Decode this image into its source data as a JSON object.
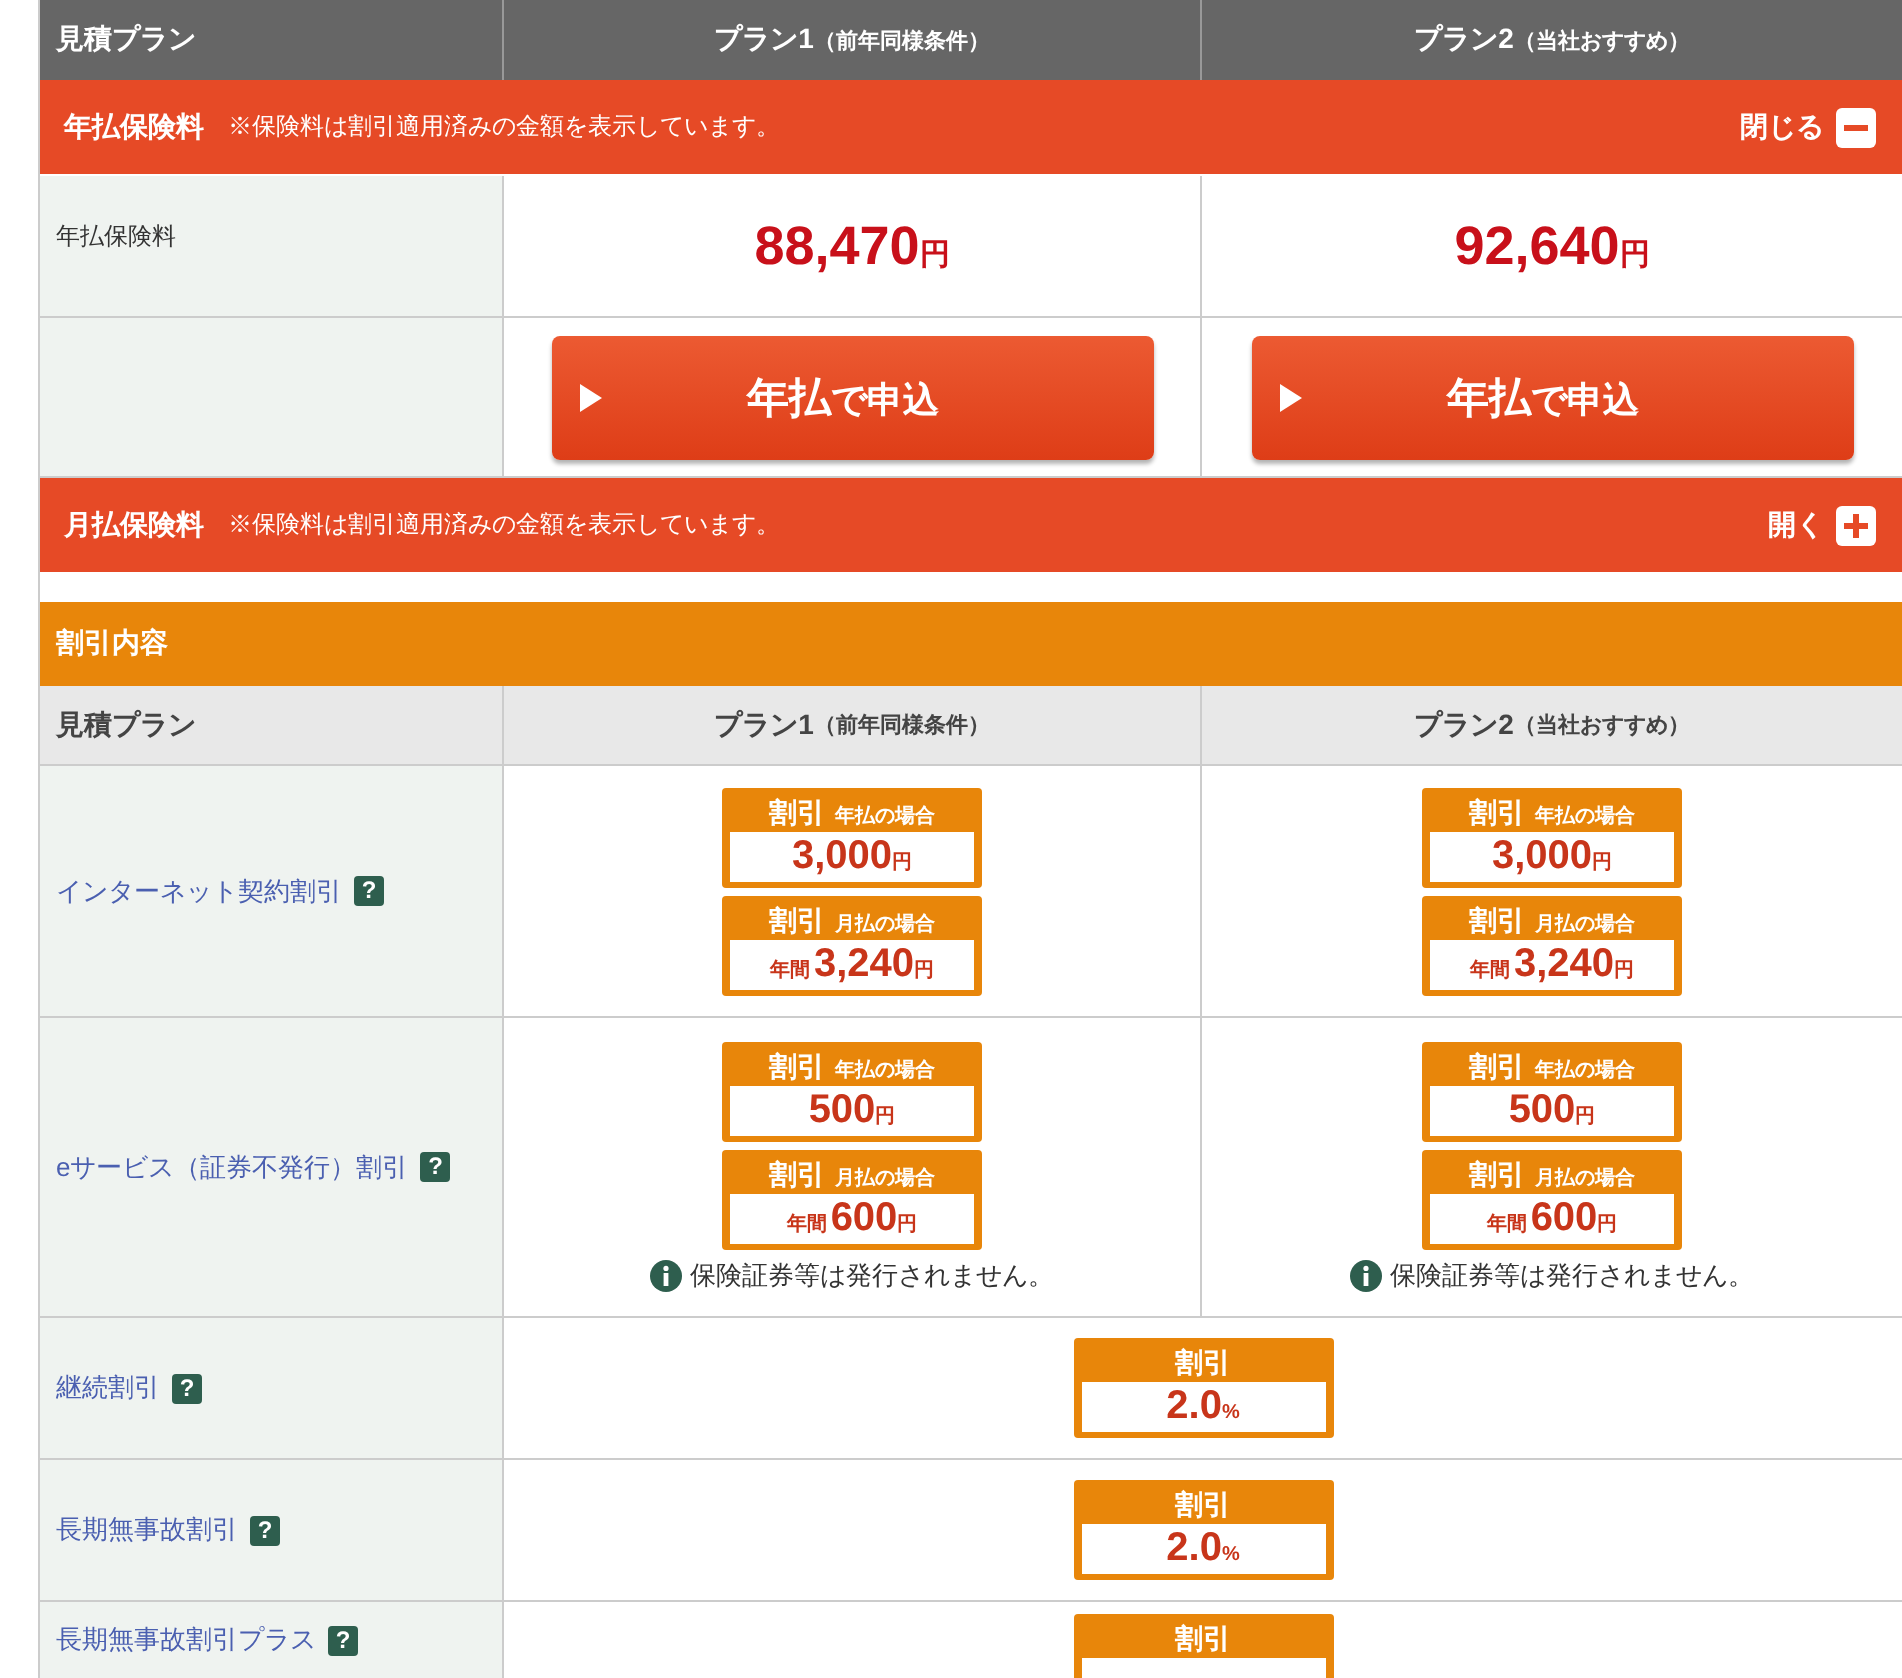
{
  "premium": {
    "header": {
      "label": "見積プラン",
      "plans": [
        {
          "name": "プラン1",
          "note": "（前年同様条件）"
        },
        {
          "name": "プラン2",
          "note": "（当社おすすめ）"
        }
      ]
    },
    "sections": [
      {
        "title": "年払保険料",
        "note": "※保険料は割引適用済みの金額を表示しています。",
        "toggle": "閉じる",
        "expanded": true,
        "row_label": "年払保険料",
        "amounts": [
          {
            "value": "88,470",
            "unit": "円"
          },
          {
            "value": "92,640",
            "unit": "円"
          }
        ],
        "buttons": [
          {
            "strong": "年払",
            "rest": "で申込"
          },
          {
            "strong": "年払",
            "rest": "で申込"
          }
        ]
      },
      {
        "title": "月払保険料",
        "note": "※保険料は割引適用済みの金額を表示しています。",
        "toggle": "開く",
        "expanded": false
      }
    ]
  },
  "discounts": {
    "title": "割引内容",
    "header": {
      "label": "見積プラン",
      "plans": [
        {
          "name": "プラン1",
          "note": "（前年同様条件）"
        },
        {
          "name": "プラン2",
          "note": "（当社おすすめ）"
        }
      ]
    },
    "rows": [
      {
        "kind": "per_plan",
        "label": "インターネット契約割引",
        "help": "?",
        "cells": [
          {
            "badges": [
              {
                "title": "割引",
                "condition": "年払の場合",
                "value": "3,000",
                "unit": "円"
              },
              {
                "title": "割引",
                "condition": "月払の場合",
                "prefix": "年間",
                "value": "3,240",
                "unit": "円"
              }
            ]
          },
          {
            "badges": [
              {
                "title": "割引",
                "condition": "年払の場合",
                "value": "3,000",
                "unit": "円"
              },
              {
                "title": "割引",
                "condition": "月払の場合",
                "prefix": "年間",
                "value": "3,240",
                "unit": "円"
              }
            ]
          }
        ]
      },
      {
        "kind": "per_plan",
        "label": "eサービス（証券不発行）割引",
        "help": "?",
        "cells": [
          {
            "badges": [
              {
                "title": "割引",
                "condition": "年払の場合",
                "value": "500",
                "unit": "円"
              },
              {
                "title": "割引",
                "condition": "月払の場合",
                "prefix": "年間",
                "value": "600",
                "unit": "円"
              }
            ],
            "note": "保険証券等は発行されません。"
          },
          {
            "badges": [
              {
                "title": "割引",
                "condition": "年払の場合",
                "value": "500",
                "unit": "円"
              },
              {
                "title": "割引",
                "condition": "月払の場合",
                "prefix": "年間",
                "value": "600",
                "unit": "円"
              }
            ],
            "note": "保険証券等は発行されません。"
          }
        ]
      },
      {
        "kind": "shared",
        "label": "継続割引",
        "help": "?",
        "badge": {
          "title": "割引",
          "value": "2.0",
          "unit": "%"
        }
      },
      {
        "kind": "shared",
        "label": "長期無事故割引",
        "help": "?",
        "badge": {
          "title": "割引",
          "value": "2.0",
          "unit": "%"
        }
      },
      {
        "kind": "shared",
        "label": "長期無事故割引プラス",
        "help": "?",
        "badge": {
          "title": "割引"
        }
      }
    ]
  }
}
